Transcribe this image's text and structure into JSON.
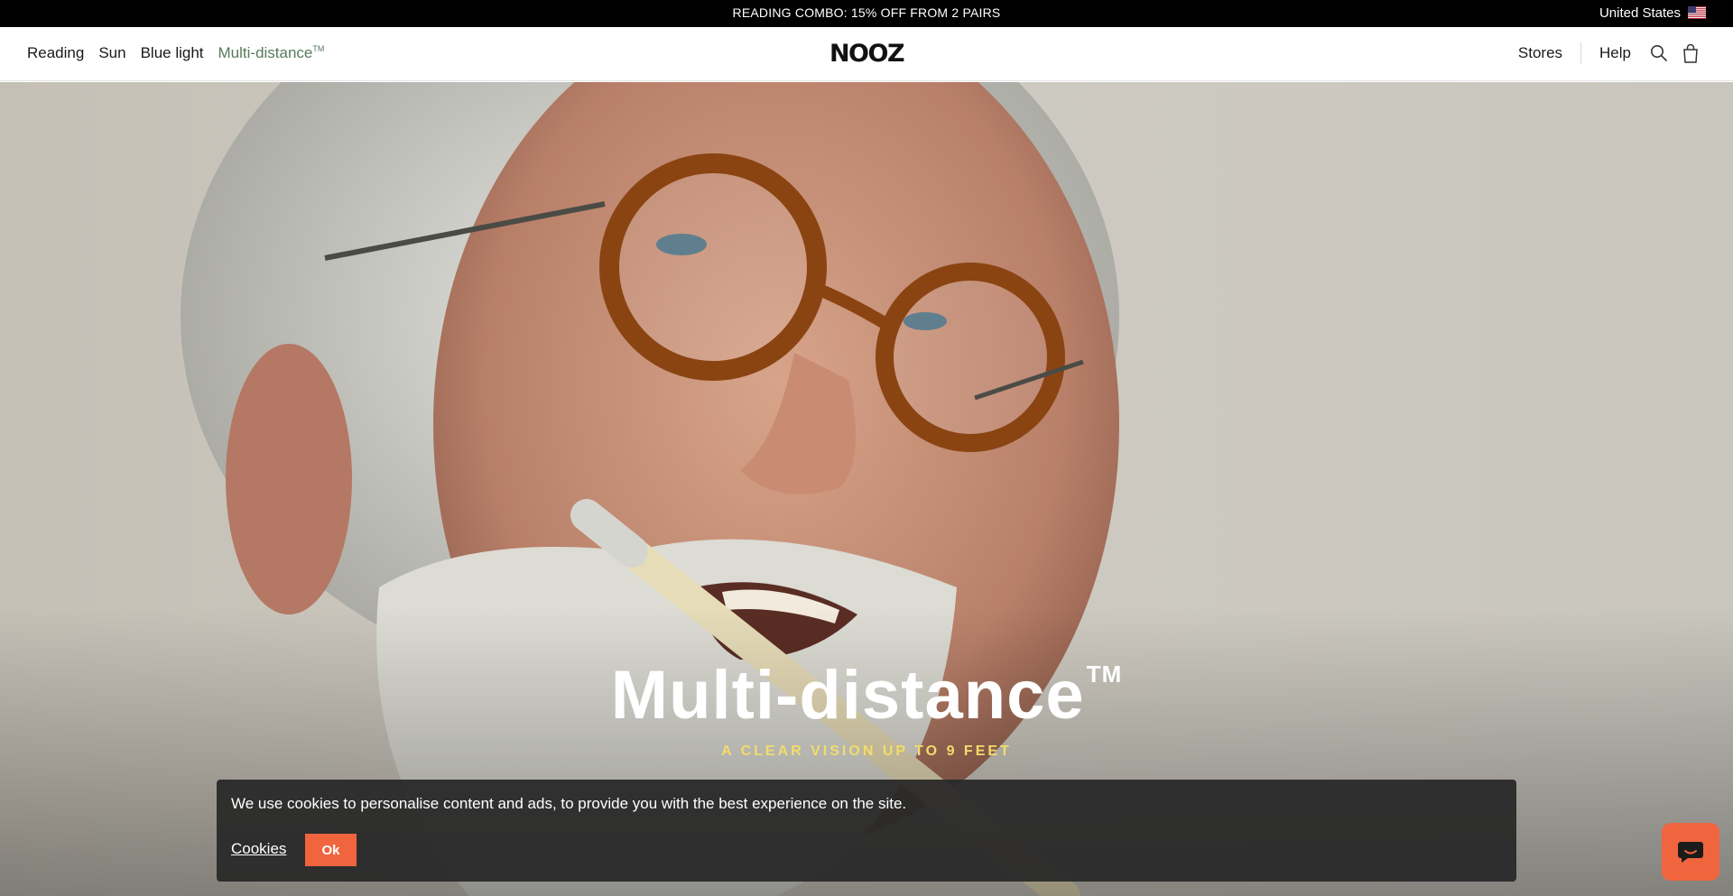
{
  "announcement": {
    "text": "READING COMBO: 15% OFF FROM 2 PAIRS",
    "country": "United States",
    "flag_icon": "us-flag-icon"
  },
  "header": {
    "nav": {
      "reading": "Reading",
      "sun": "Sun",
      "blue_light": "Blue light",
      "multi_distance": "Multi-distance",
      "multi_distance_mark": "TM"
    },
    "logo": "NOOZ",
    "stores": "Stores",
    "help": "Help",
    "search_icon": "search-icon",
    "cart_icon": "shopping-bag-icon",
    "active_color": "#587a5c"
  },
  "hero": {
    "title": "Multi-distance",
    "title_mark": "TM",
    "subtitle": "A CLEAR VISION UP TO 9 FEET",
    "subtitle_color": "#f2dc6b"
  },
  "cookie": {
    "message": "We use cookies to personalise content and ads, to provide you with the best experience on the site.",
    "link": "Cookies",
    "ok": "Ok",
    "accent": "#f0653e"
  },
  "chat": {
    "icon": "chat-bubble-icon"
  }
}
